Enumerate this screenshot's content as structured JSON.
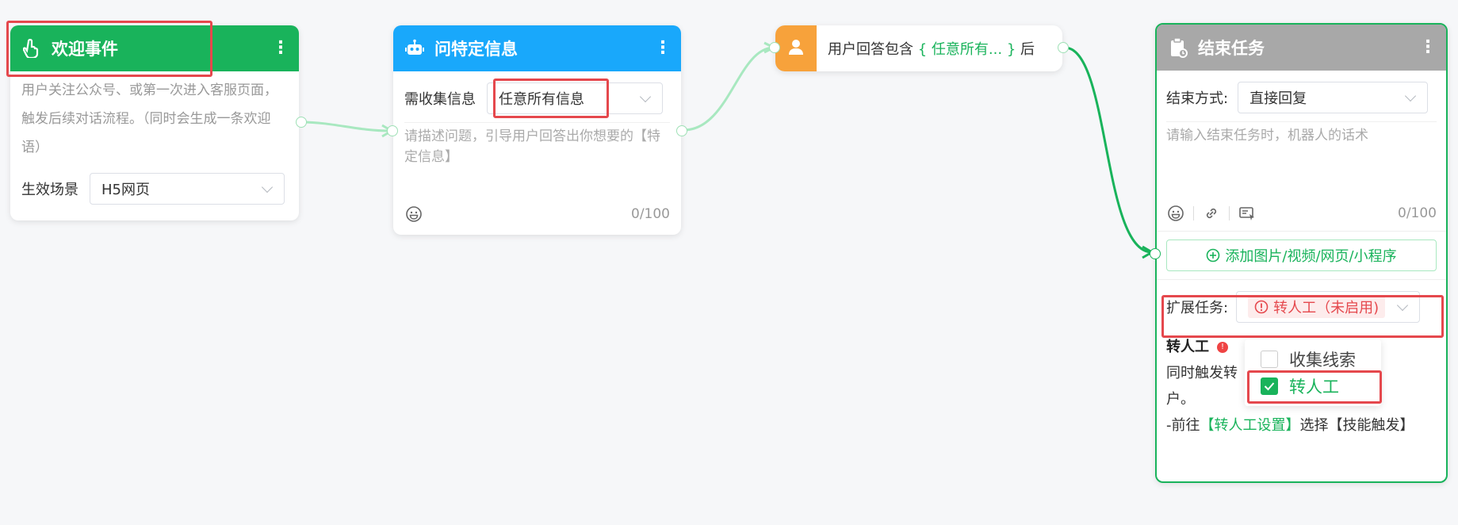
{
  "colors": {
    "green": "#19b35b",
    "blue": "#19a8fb",
    "orange": "#f7a23b",
    "gray_header": "#a8a8a8",
    "highlight_red": "#e5484d",
    "warning_red": "#ef4444"
  },
  "welcome_card": {
    "title": "欢迎事件",
    "icon": "hand-pointer-icon",
    "description": "用户关注公众号、或第一次进入客服页面，触发后续对话流程。（同时会生成一条欢迎语）",
    "scene_label": "生效场景",
    "scene_value": "H5网页"
  },
  "ask_card": {
    "title": "问特定信息",
    "icon": "robot-icon",
    "collect_label": "需收集信息",
    "collect_value": "任意所有信息",
    "placeholder": "请描述问题，引导用户回答出你想要的【特定信息】",
    "counter": "0/100"
  },
  "condition_node": {
    "icon": "user-icon",
    "prefix": "用户回答包含",
    "open_brace": "{",
    "value": "任意所有...",
    "close_brace": "}",
    "suffix": "后"
  },
  "end_card": {
    "title": "结束任务",
    "icon": "clipboard-icon",
    "method_label": "结束方式:",
    "method_value": "直接回复",
    "placeholder": "请输入结束任务时，机器人的话术",
    "counter": "0/100",
    "add_button": "添加图片/视频/网页/小程序",
    "extend_label": "扩展任务:",
    "extend_value": "转人工（未启用)",
    "transfer_title": "转人工",
    "transfer_desc_1": "同时触发转",
    "transfer_desc_2": "户。",
    "transfer_goto_prefix": "-前往",
    "transfer_goto_link": "【转人工设置】",
    "transfer_goto_suffix": "选择【技能触发】"
  },
  "dropdown": {
    "options": [
      {
        "label": "收集线索",
        "checked": false
      },
      {
        "label": "转人工",
        "checked": true
      }
    ]
  }
}
